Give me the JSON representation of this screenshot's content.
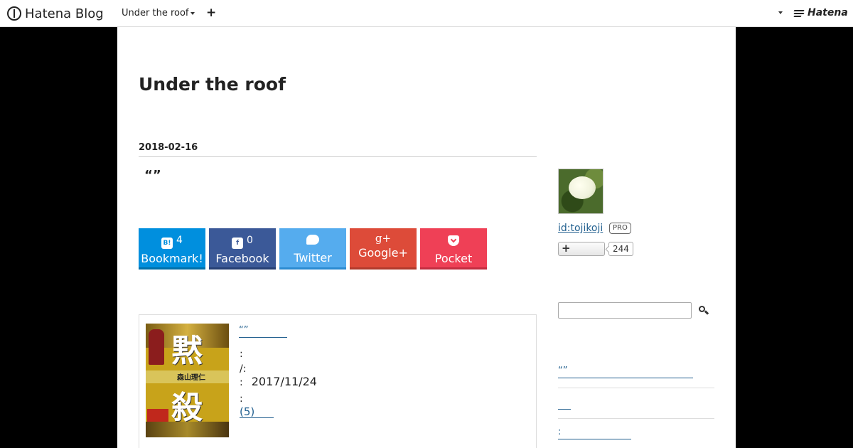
{
  "globalbar": {
    "logo_text": "Hatena Blog",
    "blog_name": "Under the roof",
    "add_label": "+",
    "brand_text": "Hatena"
  },
  "blog": {
    "title": "Under the roof"
  },
  "entry": {
    "date": "2018-02-16",
    "title": "“”"
  },
  "share": {
    "hatena": {
      "count": "4",
      "label": "Bookmark!",
      "icon": "B!"
    },
    "facebook": {
      "count": "0",
      "label": "Facebook",
      "icon": "f"
    },
    "twitter": {
      "label": "Twitter"
    },
    "googleplus": {
      "label": "Google+",
      "icon": "g+"
    },
    "pocket": {
      "label": "Pocket"
    }
  },
  "product": {
    "link_text": "“”",
    "cover_title_top": "黙",
    "cover_title_bottom": "殺",
    "cover_author": "森山理仁",
    "rows": [
      {
        "label": ":",
        "value": ""
      },
      {
        "label": "/:",
        "value": ""
      },
      {
        "label": ":",
        "value": "2017/11/24"
      },
      {
        "label": ":",
        "value": ""
      }
    ],
    "reviews": " (5)"
  },
  "sidebar": {
    "user_id": "id:tojikoji",
    "pro_label": "PRO",
    "follow_label": "+",
    "follow_count": "244",
    "search_placeholder": "",
    "links": [
      "“”",
      "",
      ":"
    ]
  },
  "colors": {
    "hatena": "#008fde",
    "facebook": "#3b5998",
    "twitter": "#55acee",
    "googleplus": "#dd4b39",
    "pocket": "#ef4056",
    "link": "#22608f"
  }
}
